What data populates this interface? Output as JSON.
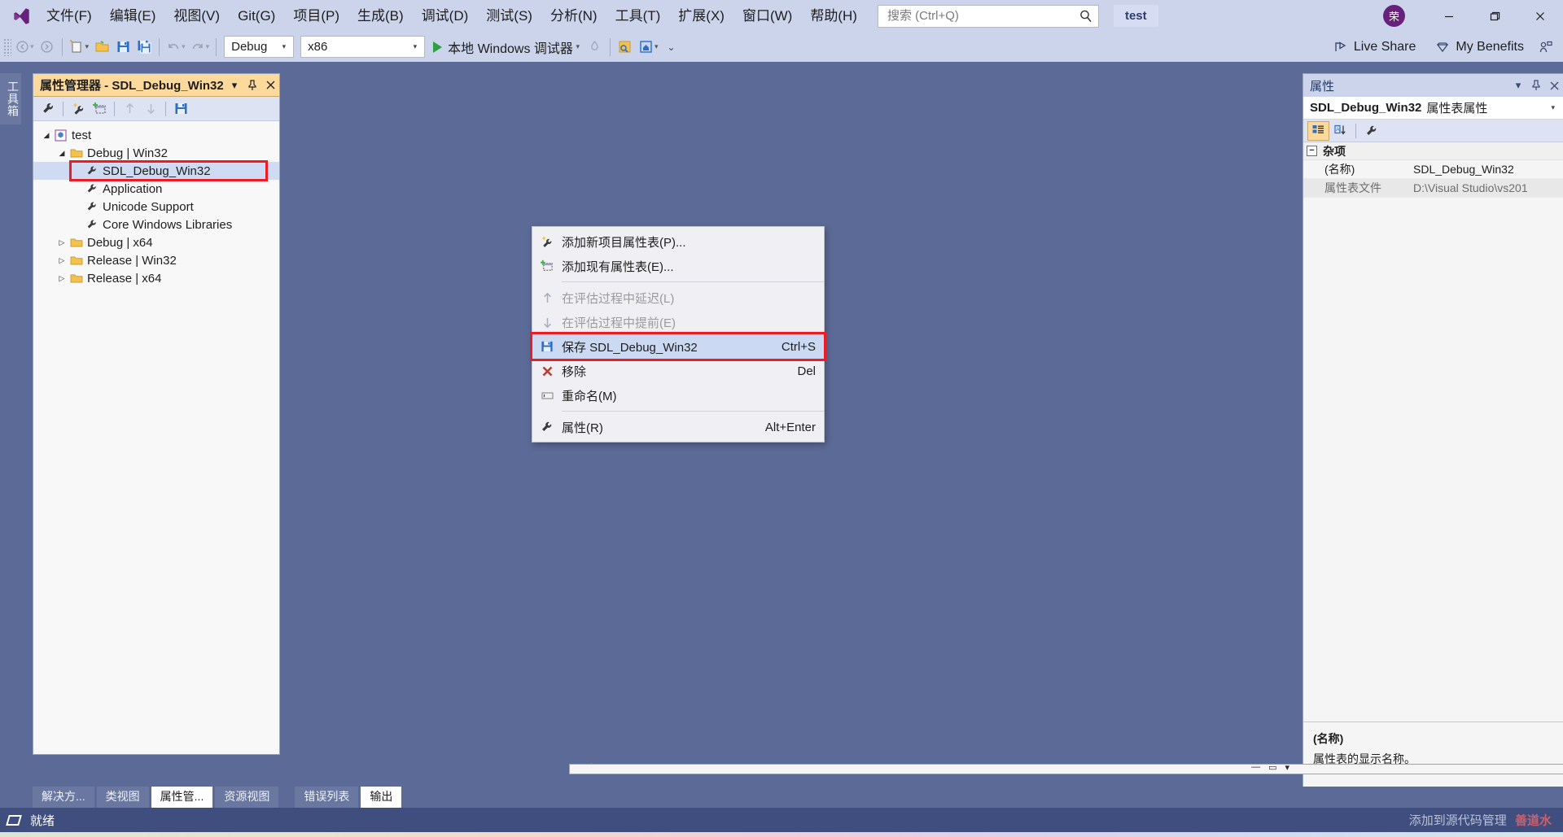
{
  "window": {
    "title": "test",
    "avatar_initial": "荣",
    "minimize": "minimize-icon",
    "maximize": "maximize-icon",
    "close": "close-icon"
  },
  "menubar": {
    "items": [
      {
        "label": "文件(F)"
      },
      {
        "label": "编辑(E)"
      },
      {
        "label": "视图(V)"
      },
      {
        "label": "Git(G)"
      },
      {
        "label": "项目(P)"
      },
      {
        "label": "生成(B)"
      },
      {
        "label": "调试(D)"
      },
      {
        "label": "测试(S)"
      },
      {
        "label": "分析(N)"
      },
      {
        "label": "工具(T)"
      },
      {
        "label": "扩展(X)"
      },
      {
        "label": "窗口(W)"
      },
      {
        "label": "帮助(H)"
      }
    ]
  },
  "search": {
    "placeholder": "搜索 (Ctrl+Q)"
  },
  "toolbar": {
    "configuration": "Debug",
    "platform": "x86",
    "run_label": "本地 Windows 调试器",
    "live_share": "Live Share",
    "my_benefits": "My Benefits"
  },
  "vertical_tab": {
    "label": "工具箱"
  },
  "property_manager": {
    "title": "属性管理器 - SDL_Debug_Win32",
    "tree": [
      {
        "depth": 0,
        "expander": "expanded",
        "icon": "solution-icon",
        "label": "test"
      },
      {
        "depth": 1,
        "expander": "expanded",
        "icon": "folder-icon",
        "label": "Debug | Win32"
      },
      {
        "depth": 2,
        "expander": "none",
        "icon": "wrench-icon",
        "label": "SDL_Debug_Win32",
        "selected": true,
        "highlighted": true
      },
      {
        "depth": 2,
        "expander": "none",
        "icon": "wrench-icon",
        "label": "Application"
      },
      {
        "depth": 2,
        "expander": "none",
        "icon": "wrench-icon",
        "label": "Unicode Support"
      },
      {
        "depth": 2,
        "expander": "none",
        "icon": "wrench-icon",
        "label": "Core Windows Libraries"
      },
      {
        "depth": 1,
        "expander": "collapsed",
        "icon": "folder-icon",
        "label": "Debug | x64"
      },
      {
        "depth": 1,
        "expander": "collapsed",
        "icon": "folder-icon",
        "label": "Release | Win32"
      },
      {
        "depth": 1,
        "expander": "collapsed",
        "icon": "folder-icon",
        "label": "Release | x64"
      }
    ]
  },
  "context_menu": {
    "items": [
      {
        "icon": "add-new-sheet-icon",
        "label": "添加新项目属性表(P)...",
        "key": "",
        "state": "normal"
      },
      {
        "icon": "add-existing-sheet-icon",
        "label": "添加现有属性表(E)...",
        "key": "",
        "state": "normal"
      },
      {
        "separator": true
      },
      {
        "icon": "arrow-up-icon",
        "label": "在评估过程中延迟(L)",
        "key": "",
        "state": "disabled"
      },
      {
        "icon": "arrow-down-icon",
        "label": "在评估过程中提前(E)",
        "key": "",
        "state": "disabled"
      },
      {
        "icon": "save-icon",
        "label": "保存 SDL_Debug_Win32",
        "key": "Ctrl+S",
        "state": "selected",
        "highlighted": true
      },
      {
        "icon": "remove-x-icon",
        "label": "移除",
        "key": "Del",
        "state": "normal"
      },
      {
        "icon": "rename-icon",
        "label": "重命名(M)",
        "key": "",
        "state": "normal"
      },
      {
        "separator": true
      },
      {
        "icon": "wrench-icon",
        "label": "属性(R)",
        "key": "Alt+Enter",
        "state": "normal"
      }
    ]
  },
  "output_pane": {
    "title": "输出"
  },
  "properties_panel": {
    "title": "属性",
    "selector_name": "SDL_Debug_Win32",
    "selector_kind": "属性表属性",
    "category": "杂项",
    "rows": [
      {
        "key": "(名称)",
        "value": "SDL_Debug_Win32",
        "readonly": false
      },
      {
        "key": "属性表文件",
        "value": "D:\\Visual Studio\\vs201",
        "readonly": true
      }
    ],
    "description_title": "(名称)",
    "description_text": "属性表的显示名称。"
  },
  "bottom_tabs": {
    "left": [
      {
        "label": "解决方...",
        "active": false
      },
      {
        "label": "类视图",
        "active": false
      },
      {
        "label": "属性管...",
        "active": true
      },
      {
        "label": "资源视图",
        "active": false
      }
    ],
    "right": [
      {
        "label": "错误列表",
        "active": false
      },
      {
        "label": "输出",
        "active": true
      }
    ]
  },
  "statusbar": {
    "status": "就绪",
    "watermark": "添加到源代码管理",
    "watermark_suffix": "善道水"
  },
  "colors": {
    "title_bg": "#ccd4ec",
    "panel_header_active": "#fdd99b",
    "workspace_bg": "#5c6a97",
    "status_bg": "#3f4e7e",
    "highlight_red": "#ed1c24",
    "selection_blue": "#cfdbf2",
    "accent_purple": "#68217a",
    "run_green": "#2f9e44"
  }
}
